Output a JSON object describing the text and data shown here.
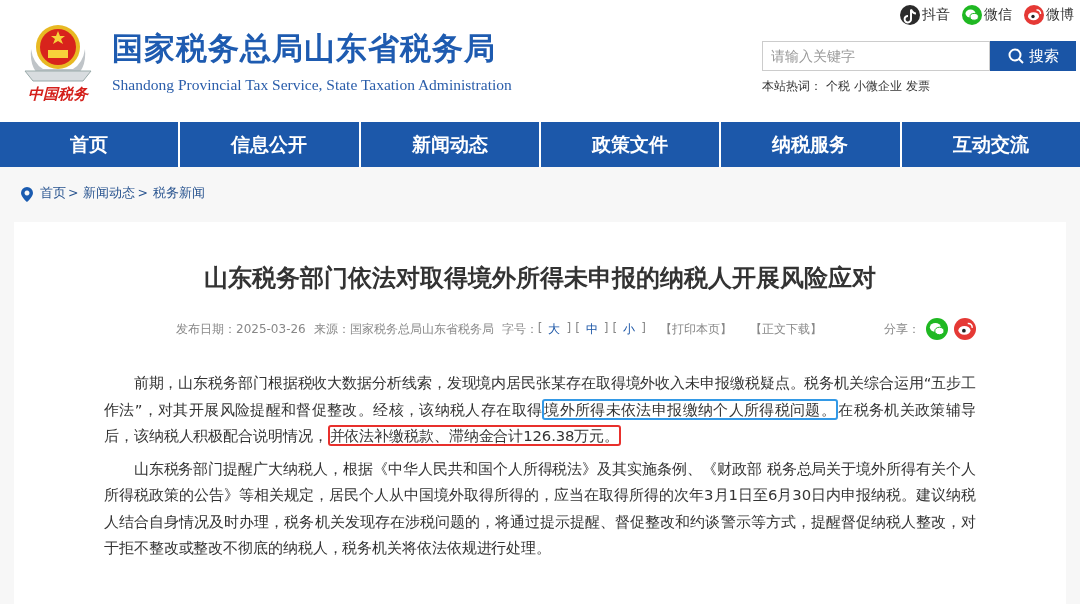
{
  "header": {
    "logo_caption": "中国税务",
    "title": "国家税务总局山东省税务局",
    "subtitle": "Shandong Provincial Tax Service, State Taxation Administration"
  },
  "social": [
    {
      "kind": "douyin",
      "label": "抖音"
    },
    {
      "kind": "wechat",
      "label": "微信"
    },
    {
      "kind": "weibo",
      "label": "微博"
    }
  ],
  "search": {
    "placeholder": "请输入关键字",
    "button": "搜索"
  },
  "hot_words": {
    "label": "本站热词：",
    "words": [
      "个税",
      "小微企业",
      "发票"
    ]
  },
  "nav": [
    "首页",
    "信息公开",
    "新闻动态",
    "政策文件",
    "纳税服务",
    "互动交流"
  ],
  "breadcrumb": [
    {
      "label": "首页",
      "separator": ">"
    },
    {
      "label": "新闻动态",
      "separator": ">"
    },
    {
      "label": "税务新闻"
    }
  ],
  "article": {
    "title": "山东税务部门依法对取得境外所得未申报的纳税人开展风险应对",
    "date": "发布日期：2025-03-26",
    "source": "来源：国家税务总局山东省税务局",
    "font_size_label": "字号：",
    "sizes": [
      {
        "open": "[",
        "label": "大",
        "close": "]"
      },
      {
        "open": "[",
        "label": "中",
        "close": "]"
      },
      {
        "open": "[",
        "label": "小",
        "close": "]"
      }
    ],
    "actions": [
      "【打印本页】",
      "【正文下载】"
    ],
    "share_label": "分享：",
    "share": [
      {
        "kind": "wechat"
      },
      {
        "kind": "weibo"
      }
    ],
    "paragraphs": [
      {
        "segments": [
          {
            "kind": "plain",
            "text": "前期，山东税务部门根据税收大数据分析线索，发现境内居民张某存在取得境外收入未申报缴税疑点。税务机关综合运用“五步工作法”，对其开展风险提醒和督促整改。经核，该纳税人存在取得"
          },
          {
            "kind": "boxed",
            "color": "#3399e6",
            "text": "境外所得未依法申报缴纳个人所得税问题。"
          },
          {
            "kind": "plain",
            "text": "在税务机关政策辅导后，该纳税人积极配合说明情况，"
          },
          {
            "kind": "boxed",
            "color": "#e8302c",
            "text": "并依法补缴税款、滞纳金合计126.38万元。"
          }
        ]
      },
      {
        "segments": [
          {
            "kind": "plain",
            "text": "山东税务部门提醒广大纳税人，根据《中华人民共和国个人所得税法》及其实施条例、《财政部 税务总局关于境外所得有关个人所得税政策的公告》等相关规定，居民个人从中国境外取得所得的，应当在取得所得的次年3月1日至6月30日内申报纳税。建议纳税人结合自身情况及时办理，税务机关发现存在涉税问题的，将通过提示提醒、督促整改和约谈警示等方式，提醒督促纳税人整改，对于拒不整改或整改不彻底的纳税人，税务机关将依法依规进行处理。"
          }
        ]
      }
    ]
  }
}
